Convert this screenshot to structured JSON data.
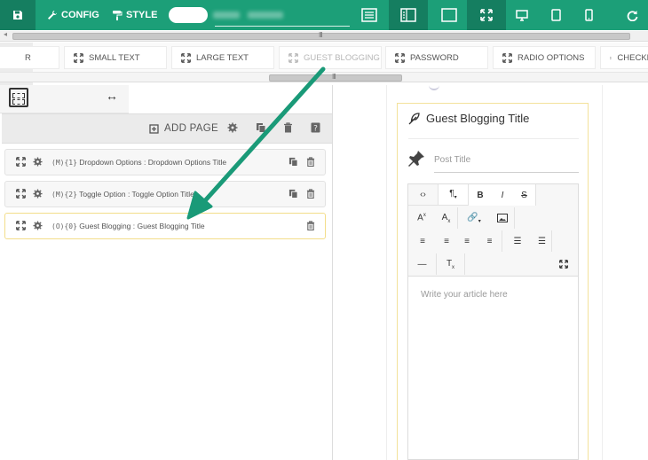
{
  "topbar": {
    "config_label": "CONFIG",
    "style_label": "STYLE"
  },
  "fields": [
    {
      "label": "R",
      "faded": false
    },
    {
      "label": "SMALL TEXT",
      "faded": false
    },
    {
      "label": "LARGE TEXT",
      "faded": false
    },
    {
      "label": "GUEST BLOGGING",
      "faded": true
    },
    {
      "label": "PASSWORD",
      "faded": false
    },
    {
      "label": "RADIO OPTIONS",
      "faded": false
    },
    {
      "label": "CHECKB",
      "faded": false
    }
  ],
  "pagebar": {
    "add_page_label": "ADD PAGE"
  },
  "rows": [
    {
      "tag": "(M){1}",
      "text": "Dropdown Options : Dropdown Options Title",
      "copyable": true
    },
    {
      "tag": "(M){2}",
      "text": "Toggle Option : Toggle Option Title",
      "copyable": true
    },
    {
      "tag": "(O){0}",
      "text": "Guest Blogging : Guest Blogging Title",
      "copyable": false
    }
  ],
  "preview": {
    "title": "Guest Blogging Title",
    "post_title_placeholder": "Post Title",
    "editor_placeholder": "Write your article here"
  },
  "colors": {
    "topbar": "#1c9f78",
    "topbar_dark": "#157e60",
    "arrow": "#1a9a78",
    "selected_border": "#f3dd8a"
  }
}
